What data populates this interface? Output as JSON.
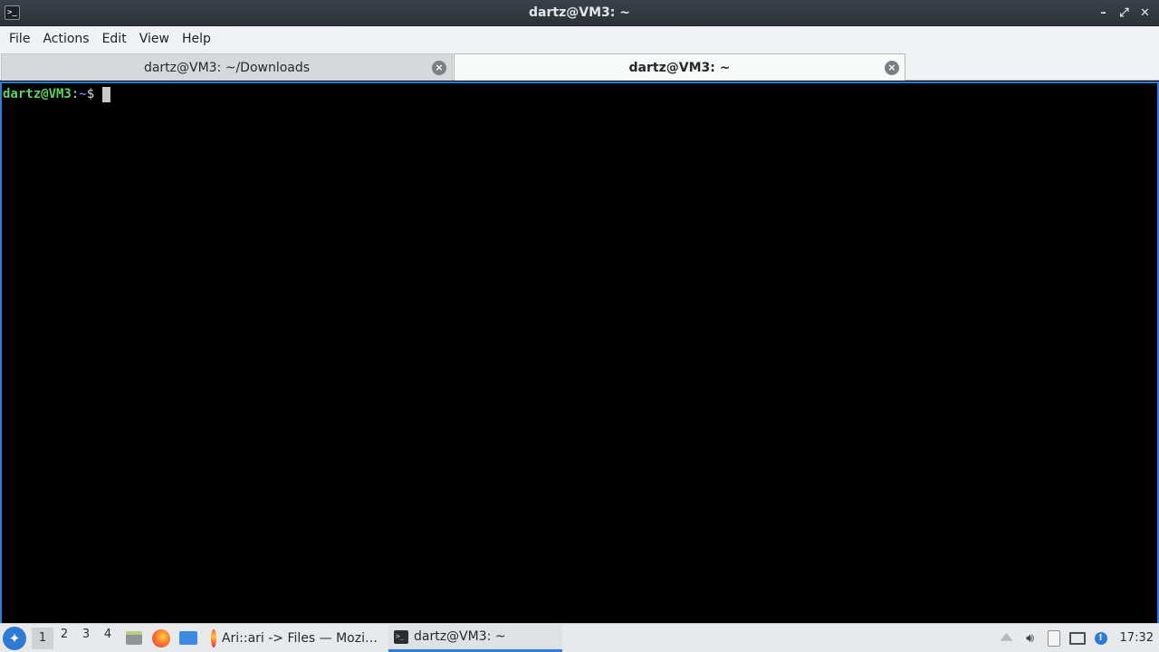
{
  "window": {
    "title": "dartz@VM3: ~",
    "icon": "terminal-icon",
    "controls": [
      "minimize-icon",
      "maximize-icon",
      "close-icon"
    ]
  },
  "menu": [
    "File",
    "Actions",
    "Edit",
    "View",
    "Help"
  ],
  "tabs": [
    {
      "label": "dartz@VM3: ~/Downloads",
      "active": false
    },
    {
      "label": "dartz@VM3: ~",
      "active": true
    }
  ],
  "terminal": {
    "prompt_user": "dartz@VM3",
    "prompt_sep": ":",
    "prompt_path": "~",
    "prompt_symbol": "$"
  },
  "taskbar": {
    "desktops": [
      "1",
      "2",
      "3",
      "4"
    ],
    "current_desktop": "1",
    "tasks": [
      {
        "label": "Ari::ari -> Files — Mozi…",
        "icon": "firefox-icon"
      },
      {
        "label": "dartz@VM3: ~",
        "icon": "terminal-icon",
        "active": true
      }
    ],
    "clock": "17:32"
  },
  "colors": {
    "accent": "#2b7fd6",
    "prompt_user": "#5fd35f",
    "prompt_path": "#6b7cff",
    "terminal_bg": "#000000"
  }
}
